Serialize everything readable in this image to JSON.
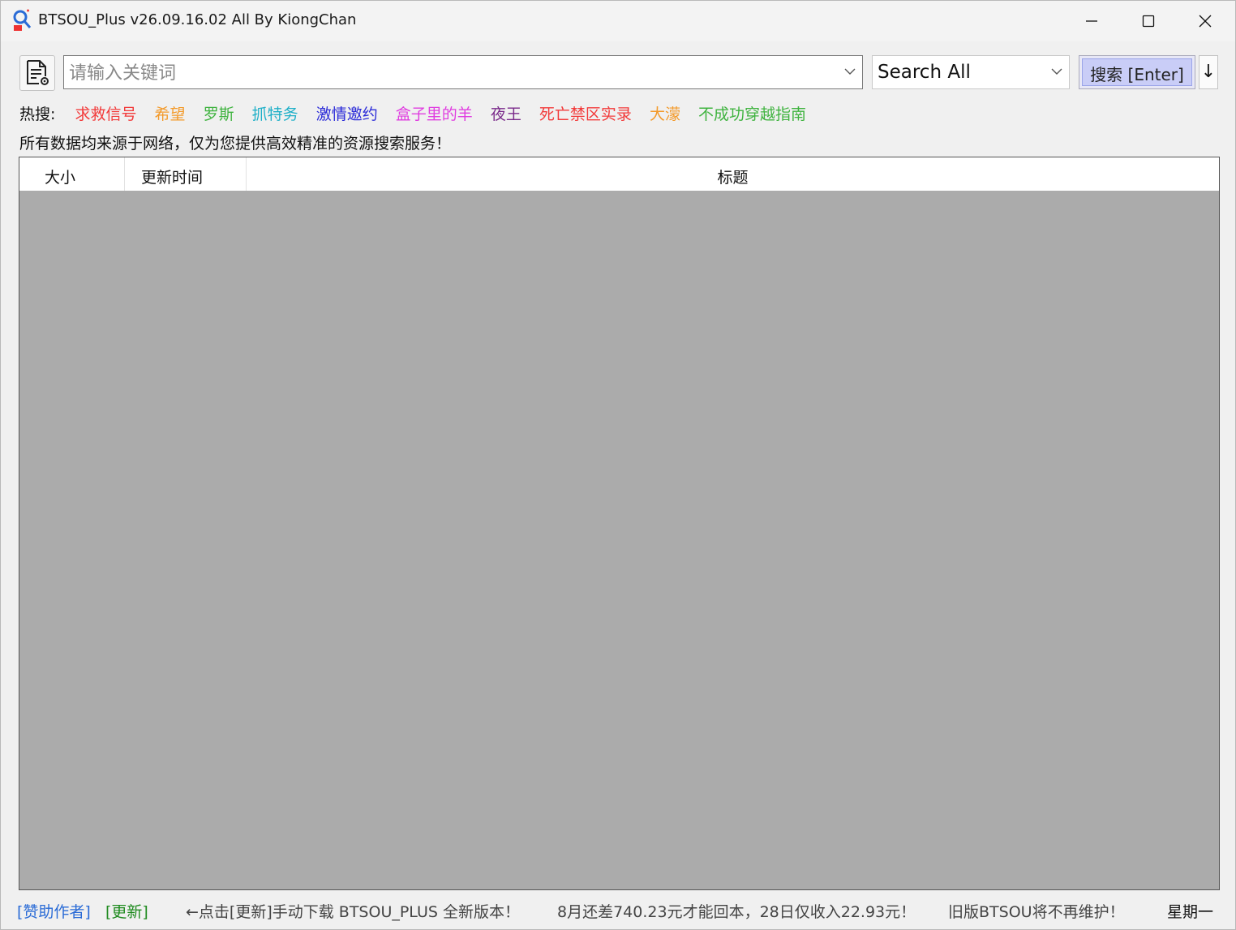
{
  "window": {
    "title": "BTSOU_Plus v26.09.16.02 All By KiongChan"
  },
  "toolbar": {
    "search_placeholder": "请输入关键词",
    "scope_value": "Search All",
    "search_button_label": "搜索 [Enter]",
    "sort_button_label": "↓"
  },
  "hot": {
    "label": "热搜:",
    "items": [
      {
        "text": "求救信号",
        "color": "#f23a3a"
      },
      {
        "text": "希望",
        "color": "#f39a2a"
      },
      {
        "text": "罗斯",
        "color": "#3fb33f"
      },
      {
        "text": "抓特务",
        "color": "#20b0c8"
      },
      {
        "text": "激情邀约",
        "color": "#2b2bd8"
      },
      {
        "text": "盒子里的羊",
        "color": "#e03ee0"
      },
      {
        "text": "夜王",
        "color": "#7a2a8a"
      },
      {
        "text": "死亡禁区实录",
        "color": "#f23a3a"
      },
      {
        "text": "大濛",
        "color": "#f39a2a"
      },
      {
        "text": "不成功穿越指南",
        "color": "#3fb33f"
      }
    ]
  },
  "notice": "所有数据均来源于网络，仅为您提供高效精准的资源搜索服务！",
  "table": {
    "columns": [
      "大小",
      "更新时间",
      "标题"
    ]
  },
  "status": {
    "sponsor": "[赞助作者]",
    "update": "[更新]",
    "message1": "←点击[更新]手动下载 BTSOU_PLUS 全新版本！",
    "message2": "8月还差740.23元才能回本，28日仅收入22.93元！",
    "message3": "旧版BTSOU将不再维护！",
    "weekday": "星期一"
  }
}
